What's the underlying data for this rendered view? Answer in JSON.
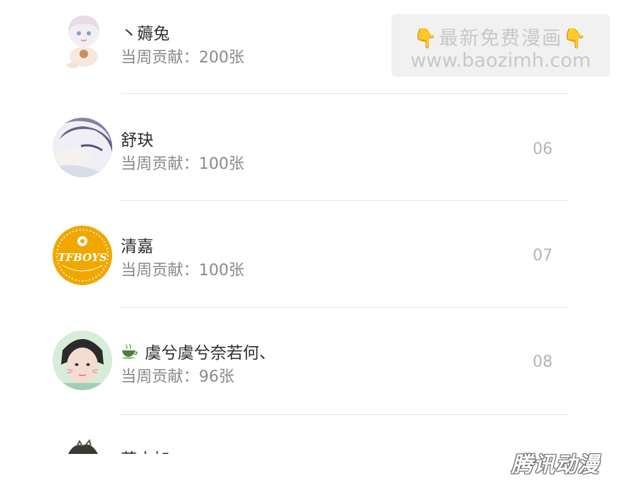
{
  "list": {
    "items": [
      {
        "name": "丶薅兔",
        "contribution": "当周贡献：200张",
        "rank": ""
      },
      {
        "name": "舒玦",
        "contribution": "当周贡献：100张",
        "rank": "06"
      },
      {
        "name": "清嘉",
        "contribution": "当周贡献：100张",
        "rank": "07"
      },
      {
        "name": "虞兮虞兮奈若何、",
        "contribution": "当周贡献：96张",
        "rank": "08"
      },
      {
        "name": "苏小加",
        "contribution": "",
        "rank": ""
      }
    ]
  },
  "avatars": {
    "badge_text": "TFBOYS"
  },
  "watermark": {
    "line1": "最新免费漫画",
    "line2": "www.baozimh.com",
    "hand_icon": "pointing-down-hand-icon"
  },
  "footer_logo": "腾讯动漫",
  "colors": {
    "divider": "#e2e2e2",
    "rank": "#b4b4b4",
    "subtext": "#8a8a8a",
    "badge": "#f0a800"
  }
}
